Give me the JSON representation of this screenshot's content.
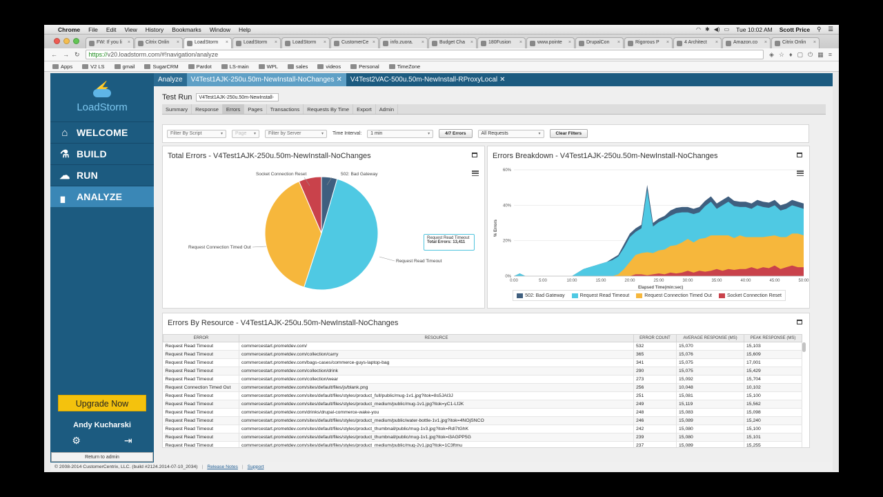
{
  "menubar": {
    "items": [
      "Chrome",
      "File",
      "Edit",
      "View",
      "History",
      "Bookmarks",
      "Window",
      "Help"
    ],
    "clock": "Tue 10:02 AM",
    "user": "Scott Price"
  },
  "browser": {
    "tabs": [
      "FW: If you li",
      "Citrix Onlin",
      "LoadStorm",
      "LoadStorm",
      "LoadStorm",
      "CustomerCe",
      "info.zuora.",
      "Budget Cha",
      "180Fusion",
      "www.pointe",
      "DrupalCon",
      "Rigorous P",
      "4 Architect",
      "Amazon.co",
      "Citrix Onlin"
    ],
    "url_https": "https://",
    "url_rest": "v20.loadstorm.com/#!navigation/analyze",
    "bookmarks": [
      "Apps",
      "V2 LS",
      "gmail",
      "SugarCRM",
      "Pardot",
      "LS-main",
      "WPL",
      "sales",
      "videos",
      "Personal",
      "TimeZone"
    ]
  },
  "sidebar": {
    "logo": "LoadStorm",
    "nav": [
      "WELCOME",
      "BUILD",
      "RUN",
      "ANALYZE"
    ],
    "upgrade": "Upgrade Now",
    "user": "Andy Kucharski",
    "return": "Return to admin"
  },
  "tabs": {
    "analyze": "Analyze",
    "t1": "V4Test1AJK-250u.50m-NewInstall-NoChanges",
    "t2": "V4Test2VAC-500u.50m-NewInstall-RProxyLocal"
  },
  "testrun": {
    "label": "Test Run",
    "value": "V4Test1AJK-250u.50m-NewInstall-"
  },
  "subtabs": [
    "Summary",
    "Response",
    "Errors",
    "Pages",
    "Transactions",
    "Requests By Time",
    "Export",
    "Admin"
  ],
  "filters": {
    "script": "Filter By Script",
    "page": "Page",
    "server": "Filter by Server",
    "interval_label": "Time Interval:",
    "interval": "1 min",
    "errors_btn": "4/7 Errors",
    "requests": "All Requests",
    "clear_btn": "Clear Filters"
  },
  "pie_panel": {
    "title": "Total Errors - V4Test1AJK-250u.50m-NewInstall-NoChanges",
    "labels": {
      "reset": "Socket Connection Reset",
      "gateway": "502: Bad Gateway",
      "timedout": "Request Connection Timed Out",
      "read": "Request Read Timeout"
    },
    "tooltip_series": "Request Read Timeout",
    "tooltip_value": "Total Errors: 13,411"
  },
  "area_panel": {
    "title": "Errors Breakdown - V4Test1AJK-250u.50m-NewInstall-NoChanges",
    "ylabel": "% Errors",
    "xlabel": "Elapsed Time(min:sec)"
  },
  "table_panel": {
    "title": "Errors By Resource - V4Test1AJK-250u.50m-NewInstall-NoChanges",
    "headers": [
      "ERROR",
      "RESOURCE",
      "ERROR COUNT",
      "AVERAGE RESPONSE (MS)",
      "PEAK RESPONSE (MS)"
    ],
    "rows": [
      [
        "Request Read Timeout",
        "commercestart.prometdev.com/",
        "532",
        "15,070",
        "15,103"
      ],
      [
        "Request Read Timeout",
        "commercestart.prometdev.com/collection/carry",
        "365",
        "15,076",
        "15,609"
      ],
      [
        "Request Read Timeout",
        "commercestart.prometdev.com/bags-cases/commerce-guys-laptop-bag",
        "341",
        "15,075",
        "17,001"
      ],
      [
        "Request Read Timeout",
        "commercestart.prometdev.com/collection/drink",
        "290",
        "15,075",
        "15,429"
      ],
      [
        "Request Read Timeout",
        "commercestart.prometdev.com/collection/wear",
        "273",
        "15,092",
        "15,704"
      ],
      [
        "Request Connection Timed Out",
        "commercestart.prometdev.com/sites/default/files/js/blank.png",
        "256",
        "10,048",
        "10,102"
      ],
      [
        "Request Read Timeout",
        "commercestart.prometdev.com/sites/default/files/styles/product_full/public/mug-1v1.jpg?itok=8s5JAI3J",
        "251",
        "15,081",
        "15,100"
      ],
      [
        "Request Read Timeout",
        "commercestart.prometdev.com/sites/default/files/styles/product_medium/public/mug-1v1.jpg?itok=yC1-LfJK",
        "249",
        "15,119",
        "15,562"
      ],
      [
        "Request Read Timeout",
        "commercestart.prometdev.com/drinks/drupal-commerce-wake-you",
        "248",
        "15,083",
        "15,098"
      ],
      [
        "Request Read Timeout",
        "commercestart.prometdev.com/sites/default/files/styles/product_medium/public/water-bottle-1v1.jpg?itok=4NOjSNCO",
        "246",
        "15,089",
        "15,240"
      ],
      [
        "Request Read Timeout",
        "commercestart.prometdev.com/sites/default/files/styles/product_thumbnail/public/mug-1v3.jpg?itok=Rdl7tGhK",
        "242",
        "15,080",
        "15,100"
      ],
      [
        "Request Read Timeout",
        "commercestart.prometdev.com/sites/default/files/styles/product_thumbnail/public/mug-1v1.jpg?itok=i3AGPP5G",
        "239",
        "15,080",
        "15,101"
      ],
      [
        "Request Read Timeout",
        "commercestart.prometdev.com/sites/default/files/styles/product_medium/public/mug-2v1.jpg?itok=1C3ftmu",
        "237",
        "15,089",
        "15,255"
      ]
    ]
  },
  "footer": {
    "copyright": "© 2008-2014 CustomerCentrix, LLC.  (build #2124.2014-07-10_2034)",
    "release": "Release Notes",
    "support": "Support"
  },
  "colors": {
    "gateway": "#3f5f7f",
    "read": "#4fc9e3",
    "timedout": "#f6b73c",
    "reset": "#c9424b",
    "sidebar": "#1c5b80"
  },
  "chart_data": [
    {
      "type": "pie",
      "title": "Total Errors - V4Test1AJK-250u.50m-NewInstall-NoChanges",
      "categories": [
        "502: Bad Gateway",
        "Request Read Timeout",
        "Request Connection Timed Out",
        "Socket Connection Reset"
      ],
      "values": [
        4.5,
        50.5,
        38.5,
        6.5
      ],
      "unit": "percent of total errors (estimated)",
      "annotations": [
        {
          "series": "Request Read Timeout",
          "total_errors": 13411
        }
      ]
    },
    {
      "type": "area",
      "title": "Errors Breakdown - V4Test1AJK-250u.50m-NewInstall-NoChanges",
      "xlabel": "Elapsed Time(min:sec)",
      "ylabel": "% Errors",
      "x_ticks": [
        "0:00",
        "5:00",
        "10:00",
        "15:00",
        "20:00",
        "25:00",
        "30:00",
        "35:00",
        "40:00",
        "45:00",
        "50:00"
      ],
      "y_ticks": [
        "0%",
        "20%",
        "40%",
        "60%"
      ],
      "ylim": [
        0,
        60
      ],
      "stacked": true,
      "x_minutes": [
        0,
        1,
        2,
        3,
        4,
        5,
        6,
        7,
        8,
        9,
        10,
        11,
        12,
        13,
        14,
        15,
        16,
        17,
        18,
        19,
        20,
        21,
        22,
        23,
        24,
        25,
        26,
        27,
        28,
        29,
        30,
        31,
        32,
        33,
        34,
        35,
        36,
        37,
        38,
        39,
        40,
        41,
        42,
        43,
        44,
        45,
        46,
        47,
        48,
        49,
        50
      ],
      "series": [
        {
          "name": "Socket Connection Reset",
          "values": [
            0,
            0,
            0,
            0,
            0,
            0,
            0,
            0,
            0,
            0,
            0,
            0,
            0,
            0,
            0,
            0,
            0,
            0,
            0,
            0,
            0,
            1,
            1,
            0.5,
            1,
            1.5,
            1,
            2,
            1.5,
            2,
            3,
            2,
            3,
            2.5,
            3,
            4,
            3,
            4,
            3.5,
            4,
            4,
            5,
            4,
            5,
            4.5,
            6,
            4,
            5,
            6,
            5,
            5
          ]
        },
        {
          "name": "Request Connection Timed Out",
          "values": [
            0,
            0,
            0,
            0,
            0,
            0,
            0,
            0,
            0,
            0,
            0,
            0,
            0,
            0,
            0,
            0,
            0,
            0,
            1,
            4,
            8,
            11,
            12,
            13,
            12,
            13,
            14,
            15,
            16,
            17,
            18,
            17,
            18,
            19,
            20,
            19,
            20,
            19,
            18,
            19,
            18,
            17,
            18,
            17,
            18,
            17,
            18,
            17,
            18,
            19,
            18
          ]
        },
        {
          "name": "Request Read Timeout",
          "values": [
            0,
            1.5,
            0,
            0,
            0,
            0,
            0,
            0,
            0,
            0,
            0,
            2,
            4,
            5,
            6,
            7,
            8,
            9,
            10,
            12,
            14,
            13,
            14,
            35,
            15,
            16,
            17,
            17,
            18,
            17,
            15,
            16,
            15,
            18,
            19,
            15,
            17,
            19,
            18,
            16,
            17,
            16,
            18,
            17,
            16,
            17,
            15,
            16,
            16,
            15,
            15
          ]
        },
        {
          "name": "502: Bad Gateway",
          "values": [
            0,
            0,
            0,
            0,
            0,
            0,
            0,
            0,
            0,
            0,
            0,
            0,
            0,
            0,
            0,
            0,
            0,
            1,
            1,
            2,
            2,
            2,
            2,
            3,
            2,
            2,
            2,
            3,
            3,
            3,
            3,
            3,
            3,
            3,
            3,
            3,
            3,
            3,
            3,
            3,
            3,
            3,
            3,
            3,
            3,
            3,
            3,
            3,
            3,
            3,
            3
          ]
        }
      ]
    }
  ]
}
